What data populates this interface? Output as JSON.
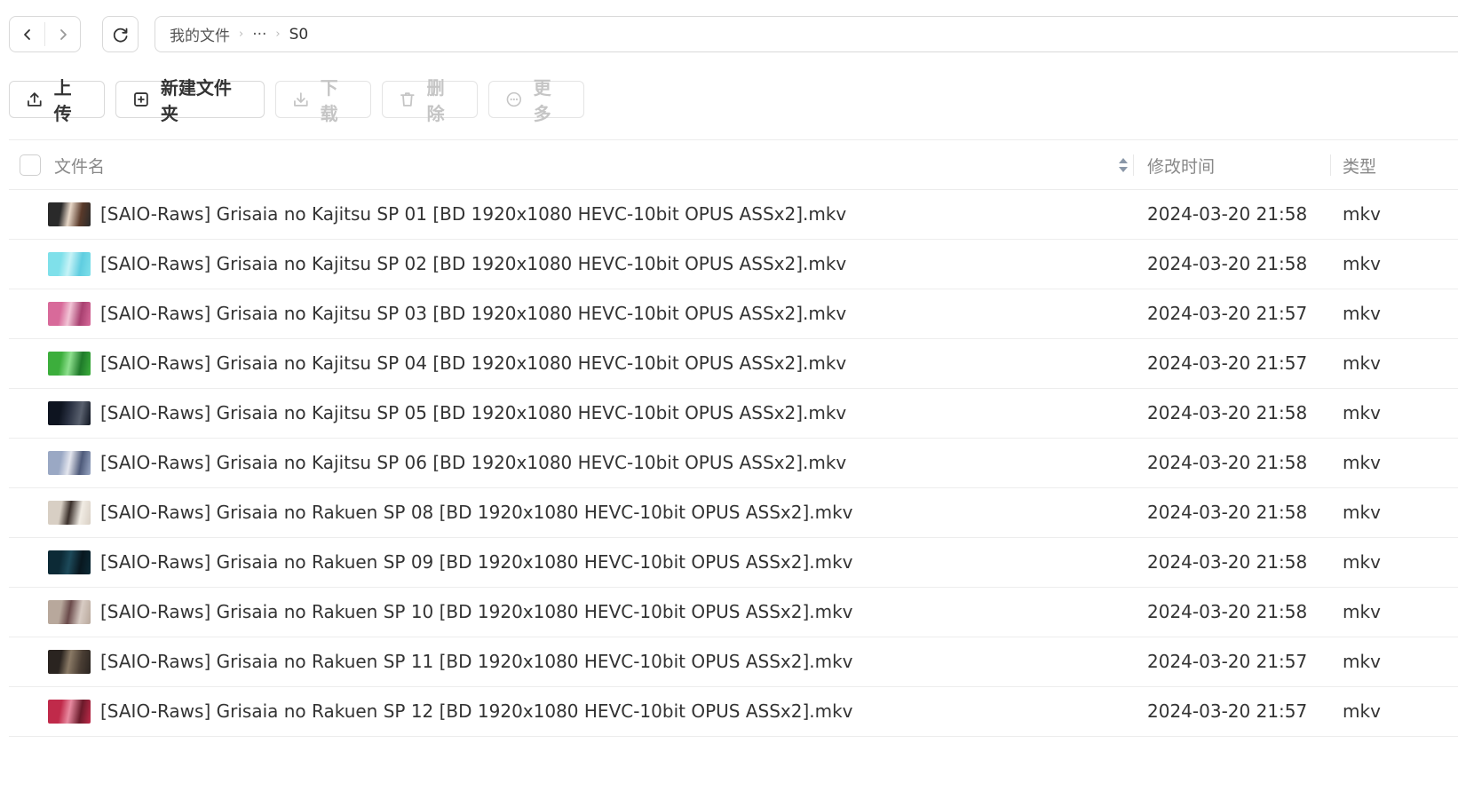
{
  "nav": {
    "back_icon": "chevron-left-icon",
    "forward_icon": "chevron-right-icon",
    "refresh_icon": "refresh-icon"
  },
  "breadcrumb": {
    "root": "我的文件",
    "ellipsis": "···",
    "current": "S0"
  },
  "toolbar": {
    "upload": "上传",
    "new_folder": "新建文件夹",
    "download": "下载",
    "delete": "删除",
    "more": "更多"
  },
  "table": {
    "headers": {
      "name": "文件名",
      "modified": "修改时间",
      "type": "类型"
    },
    "rows": [
      {
        "name": "[SAIO-Raws] Grisaia no Kajitsu SP 01 [BD 1920x1080 HEVC-10bit OPUS ASSx2].mkv",
        "modified": "2024-03-20 21:58",
        "type": "mkv",
        "thumb_colors": [
          "#2a2a2a",
          "#e8d8c8",
          "#5a3a2a"
        ]
      },
      {
        "name": "[SAIO-Raws] Grisaia no Kajitsu SP 02 [BD 1920x1080 HEVC-10bit OPUS ASSx2].mkv",
        "modified": "2024-03-20 21:58",
        "type": "mkv",
        "thumb_colors": [
          "#7fe0ea",
          "#c6f3f7",
          "#5fcde0"
        ]
      },
      {
        "name": "[SAIO-Raws] Grisaia no Kajitsu SP 03 [BD 1920x1080 HEVC-10bit OPUS ASSx2].mkv",
        "modified": "2024-03-20 21:57",
        "type": "mkv",
        "thumb_colors": [
          "#d86a9a",
          "#f2c4d6",
          "#a84070"
        ]
      },
      {
        "name": "[SAIO-Raws] Grisaia no Kajitsu SP 04 [BD 1920x1080 HEVC-10bit OPUS ASSx2].mkv",
        "modified": "2024-03-20 21:57",
        "type": "mkv",
        "thumb_colors": [
          "#3cae3c",
          "#8ee08e",
          "#1f7a2a"
        ]
      },
      {
        "name": "[SAIO-Raws] Grisaia no Kajitsu SP 05 [BD 1920x1080 HEVC-10bit OPUS ASSx2].mkv",
        "modified": "2024-03-20 21:58",
        "type": "mkv",
        "thumb_colors": [
          "#0e1420",
          "#2a3142",
          "#59606e"
        ]
      },
      {
        "name": "[SAIO-Raws] Grisaia no Kajitsu SP 06 [BD 1920x1080 HEVC-10bit OPUS ASSx2].mkv",
        "modified": "2024-03-20 21:58",
        "type": "mkv",
        "thumb_colors": [
          "#9aa8c4",
          "#e4e6ee",
          "#4e5a7a"
        ]
      },
      {
        "name": "[SAIO-Raws] Grisaia no Rakuen SP 08 [BD 1920x1080 HEVC-10bit OPUS ASSx2].mkv",
        "modified": "2024-03-20 21:58",
        "type": "mkv",
        "thumb_colors": [
          "#d8cfc4",
          "#3a2f2a",
          "#f1ece4"
        ]
      },
      {
        "name": "[SAIO-Raws] Grisaia no Rakuen SP 09 [BD 1920x1080 HEVC-10bit OPUS ASSx2].mkv",
        "modified": "2024-03-20 21:58",
        "type": "mkv",
        "thumb_colors": [
          "#0c2a36",
          "#1d4a5a",
          "#08171f"
        ]
      },
      {
        "name": "[SAIO-Raws] Grisaia no Rakuen SP 10 [BD 1920x1080 HEVC-10bit OPUS ASSx2].mkv",
        "modified": "2024-03-20 21:58",
        "type": "mkv",
        "thumb_colors": [
          "#b8a89c",
          "#6a4a4a",
          "#d8ccc4"
        ]
      },
      {
        "name": "[SAIO-Raws] Grisaia no Rakuen SP 11 [BD 1920x1080 HEVC-10bit OPUS ASSx2].mkv",
        "modified": "2024-03-20 21:57",
        "type": "mkv",
        "thumb_colors": [
          "#2a2420",
          "#8a7a66",
          "#4a3e34"
        ]
      },
      {
        "name": "[SAIO-Raws] Grisaia no Rakuen SP 12 [BD 1920x1080 HEVC-10bit OPUS ASSx2].mkv",
        "modified": "2024-03-20 21:57",
        "type": "mkv",
        "thumb_colors": [
          "#c02a4a",
          "#e88aa0",
          "#6a1a2a"
        ]
      }
    ]
  }
}
